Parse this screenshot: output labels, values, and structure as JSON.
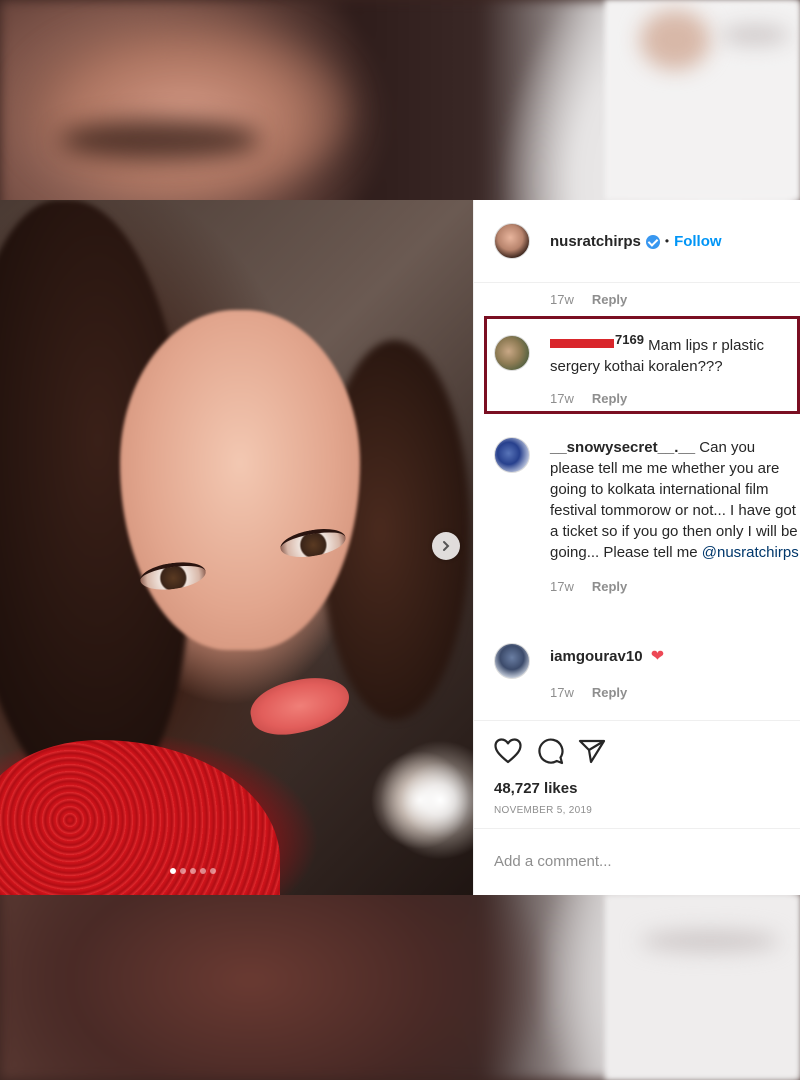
{
  "post": {
    "username": "nusratchirps",
    "separator": "•",
    "follow_label": "Follow",
    "carousel": {
      "total": 5,
      "active": 1
    }
  },
  "comments": [
    {
      "time": "17w",
      "reply": "Reply"
    },
    {
      "user_tail": "7169",
      "text": "Mam lips r plastic sergery kothai koralen???",
      "time": "17w",
      "reply": "Reply"
    },
    {
      "user": "__snowysecret__.__",
      "text": "Can you please tell me me whether you are going to kolkata international film festival tommorow or not... I have got a ticket so if you go then only I will be going... Please tell me",
      "mention": "@nusratchirps",
      "time": "17w",
      "reply": "Reply"
    },
    {
      "user": "iamgourav10",
      "emoji": "❤",
      "time": "17w",
      "reply": "Reply"
    }
  ],
  "likes": "48,727 likes",
  "date": "NOVEMBER 5, 2019",
  "add_comment_placeholder": "Add a comment...",
  "colors": {
    "accent": "#0095f6",
    "highlight_border": "#7a0f22",
    "redaction": "#d9262b",
    "heart": "#ed4956"
  },
  "icons": [
    "verified-badge-icon",
    "next-arrow-icon",
    "heart-icon",
    "comment-icon",
    "share-icon"
  ]
}
